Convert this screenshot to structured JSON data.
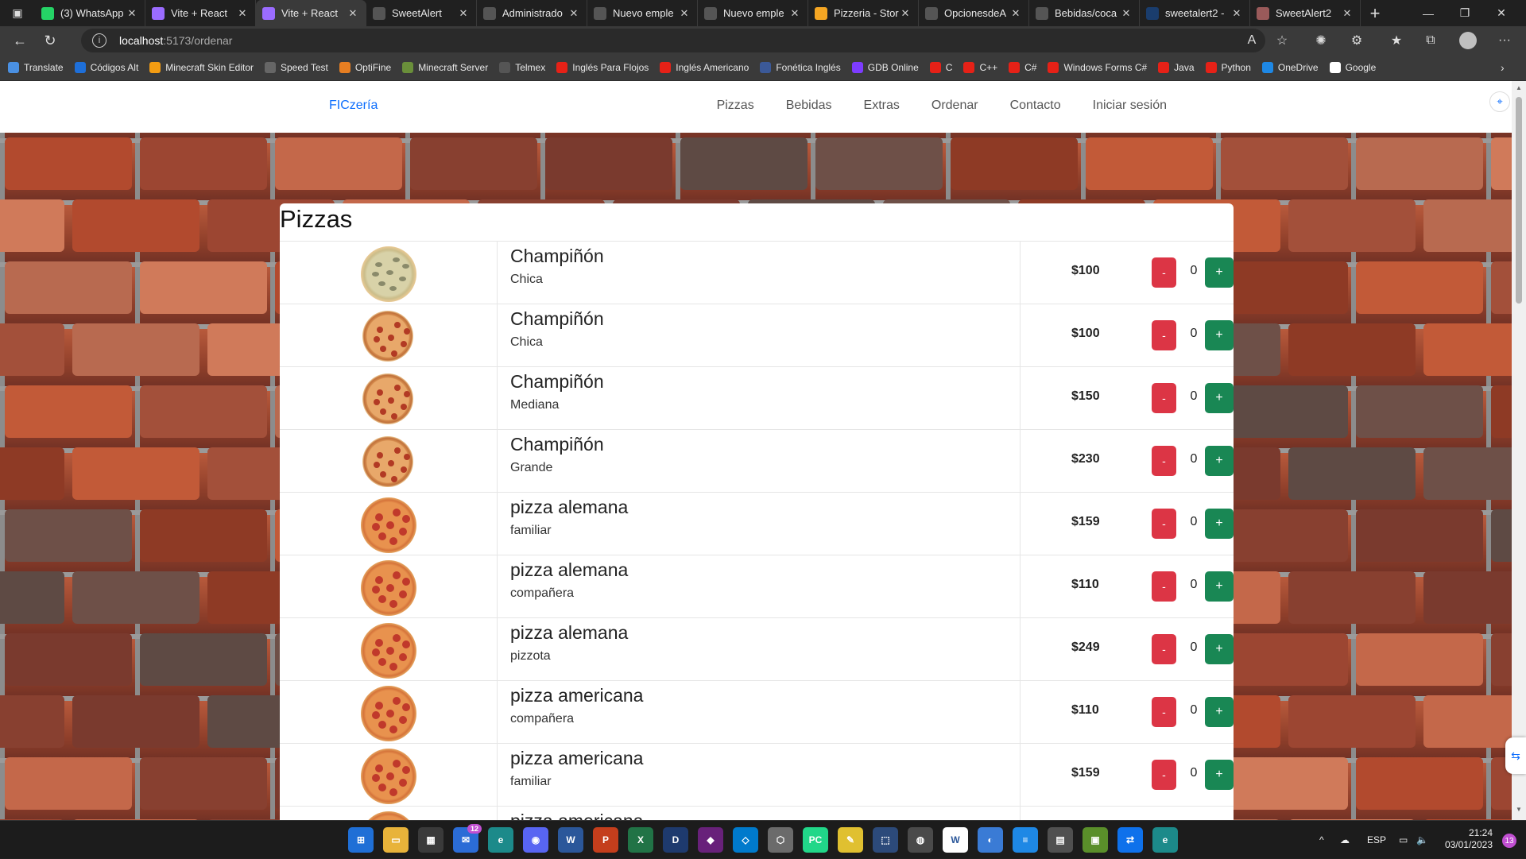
{
  "browser": {
    "tabs": [
      {
        "label": "(3) WhatsApp",
        "color": "#25d366"
      },
      {
        "label": "Vite + React",
        "color": "#9b6cff"
      },
      {
        "label": "Vite + React",
        "color": "#9b6cff"
      },
      {
        "label": "SweetAlert",
        "color": "#555555"
      },
      {
        "label": "Administrado",
        "color": "#555555"
      },
      {
        "label": "Nuevo emple",
        "color": "#555555"
      },
      {
        "label": "Nuevo emple",
        "color": "#555555"
      },
      {
        "label": "Pizzeria - Stor",
        "color": "#f5a623"
      },
      {
        "label": "OpcionesdeA",
        "color": "#555555"
      },
      {
        "label": "Bebidas/coca",
        "color": "#555555"
      },
      {
        "label": "sweetalert2 -",
        "color": "#1a3d6d"
      },
      {
        "label": "SweetAlert2",
        "color": "#9a5a5a"
      }
    ],
    "url_host": "localhost",
    "url_path": ":5173/ordenar",
    "bookmarks": [
      {
        "label": "Translate",
        "color": "#4a90e2"
      },
      {
        "label": "Códigos Alt",
        "color": "#1e6fd9"
      },
      {
        "label": "Minecraft Skin Editor",
        "color": "#f39c12"
      },
      {
        "label": "Speed Test",
        "color": "#666666"
      },
      {
        "label": "OptiFine",
        "color": "#e67e22"
      },
      {
        "label": "Minecraft Server",
        "color": "#6a8f3a"
      },
      {
        "label": "Telmex",
        "color": "#555555"
      },
      {
        "label": "Inglés Para Flojos",
        "color": "#e62117"
      },
      {
        "label": "Inglés Americano",
        "color": "#e62117"
      },
      {
        "label": "Fonética Inglés",
        "color": "#3b5998"
      },
      {
        "label": "GDB Online",
        "color": "#7d3cff"
      },
      {
        "label": "C",
        "color": "#e62117"
      },
      {
        "label": "C++",
        "color": "#e62117"
      },
      {
        "label": "C#",
        "color": "#e62117"
      },
      {
        "label": "Windows Forms C#",
        "color": "#e62117"
      },
      {
        "label": "Java",
        "color": "#e62117"
      },
      {
        "label": "Python",
        "color": "#e62117"
      },
      {
        "label": "OneDrive",
        "color": "#1e88e5"
      },
      {
        "label": "Google",
        "color": "#ffffff"
      }
    ]
  },
  "site": {
    "brand": "FICzería",
    "nav": [
      "Pizzas",
      "Bebidas",
      "Extras",
      "Ordenar",
      "Contacto",
      "Iniciar sesión"
    ]
  },
  "section_title": "Pizzas",
  "products": [
    {
      "name": "Champiñón",
      "size": "Chica",
      "price": "$100",
      "qty": "0",
      "img": "mush"
    },
    {
      "name": "Champiñón",
      "size": "Chica",
      "price": "$100",
      "qty": "0",
      "img": "small"
    },
    {
      "name": "Champiñón",
      "size": "Mediana",
      "price": "$150",
      "qty": "0",
      "img": "small"
    },
    {
      "name": "Champiñón",
      "size": "Grande",
      "price": "$230",
      "qty": "0",
      "img": "small"
    },
    {
      "name": "pizza alemana",
      "size": "familiar",
      "price": "$159",
      "qty": "0",
      "img": "pep"
    },
    {
      "name": "pizza alemana",
      "size": "compañera",
      "price": "$110",
      "qty": "0",
      "img": "pep"
    },
    {
      "name": "pizza alemana",
      "size": "pizzota",
      "price": "$249",
      "qty": "0",
      "img": "pep"
    },
    {
      "name": "pizza americana",
      "size": "compañera",
      "price": "$110",
      "qty": "0",
      "img": "pep"
    },
    {
      "name": "pizza americana",
      "size": "familiar",
      "price": "$159",
      "qty": "0",
      "img": "pep"
    },
    {
      "name": "pizza americana",
      "size": "",
      "price": "",
      "qty": "",
      "img": "pep"
    }
  ],
  "buttons": {
    "minus": "-",
    "plus": "+"
  },
  "taskbar": {
    "mail_badge": "12",
    "lang": "ESP",
    "time": "21:24",
    "date": "03/01/2023",
    "notifications": "13"
  }
}
